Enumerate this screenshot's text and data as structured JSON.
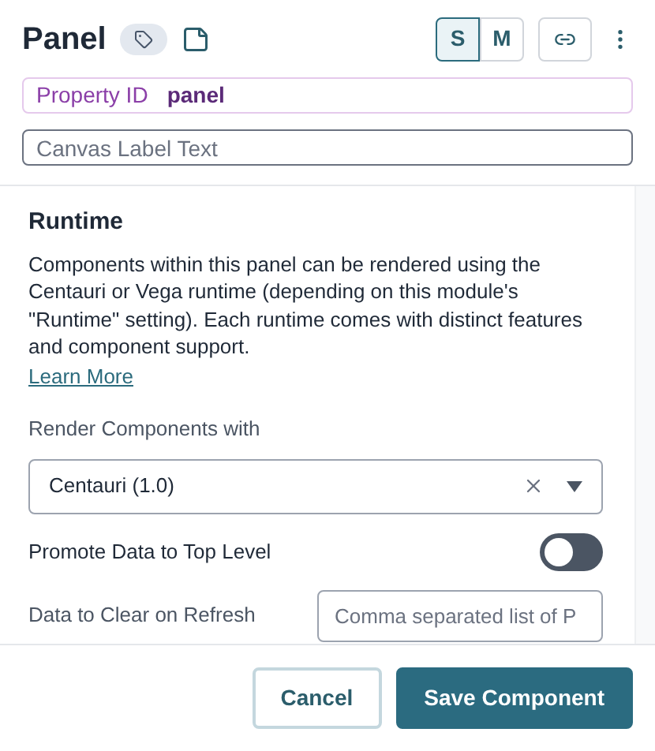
{
  "header": {
    "title": "Panel",
    "sizes": [
      {
        "label": "S",
        "selected": true
      },
      {
        "label": "M",
        "selected": false
      }
    ]
  },
  "property_id": {
    "label": "Property ID",
    "value": "panel"
  },
  "canvas_label": {
    "placeholder": "Canvas Label Text"
  },
  "runtime": {
    "heading": "Runtime",
    "description": "Components within this panel can be rendered using the Centauri or Vega runtime (depending on this module's \"Runtime\" setting). Each runtime comes with distinct features and component support.",
    "link": "Learn More",
    "render_label": "Render Components with",
    "render_value": "Centauri (1.0)",
    "promote_label": "Promote Data to Top Level",
    "promote_on": false,
    "clear_label": "Data to Clear on Refresh",
    "clear_placeholder": "Comma separated list of P"
  },
  "buttons": [
    {
      "label": "Cancel",
      "kind": "secondary"
    },
    {
      "label": "Save Component",
      "kind": "primary"
    }
  ]
}
